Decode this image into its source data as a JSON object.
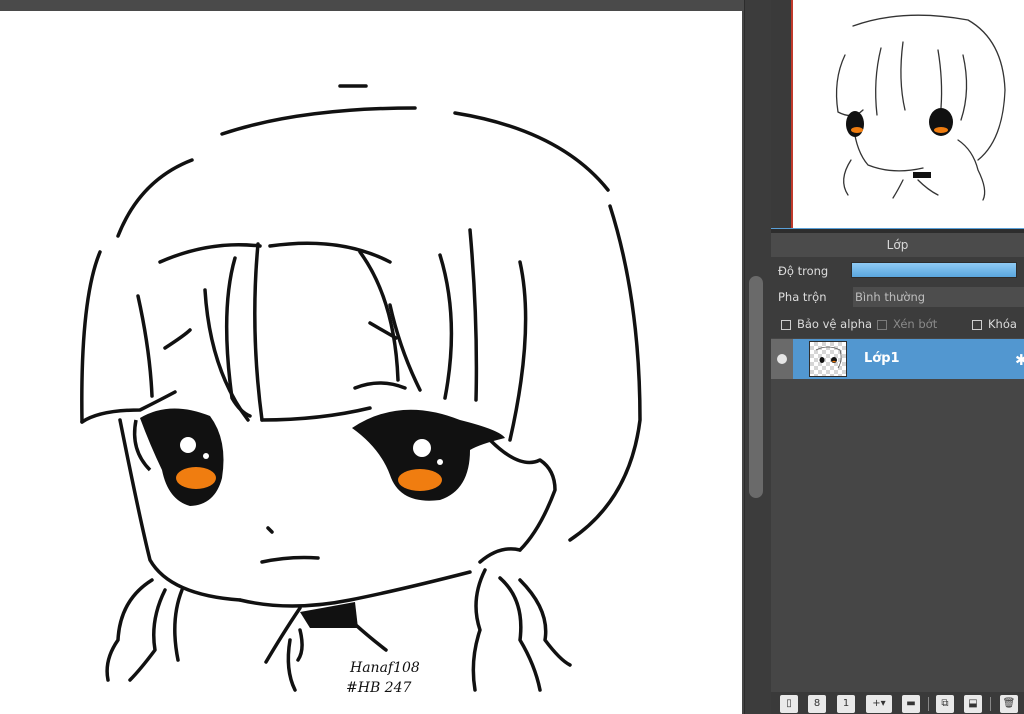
{
  "layer_panel": {
    "title": "Lớp",
    "opacity_label": "Độ trong",
    "opacity_value": 1.0,
    "blend_label": "Pha trộn",
    "blend_value": "Bình thường",
    "protect_alpha_label": "Bảo vệ alpha",
    "clipping_label": "Xén bớt",
    "lock_label": "Khóa",
    "layers": [
      {
        "name": "Lớp1",
        "visible": true,
        "selected": true
      }
    ]
  },
  "canvas": {
    "signature_line1": "Hanaf108",
    "signature_line2": "#HB 247"
  },
  "toolbar_icons": [
    "new-layer-icon",
    "new-layer-8bit-icon",
    "new-layer-1bit-icon",
    "add-layer-menu-icon",
    "new-folder-icon",
    "duplicate-layer-icon",
    "merge-down-icon",
    "delete-layer-icon"
  ],
  "colors": {
    "accent": "#5297d0",
    "eye_orange": "#f07d10",
    "panel_bg": "#3c3c3c"
  }
}
